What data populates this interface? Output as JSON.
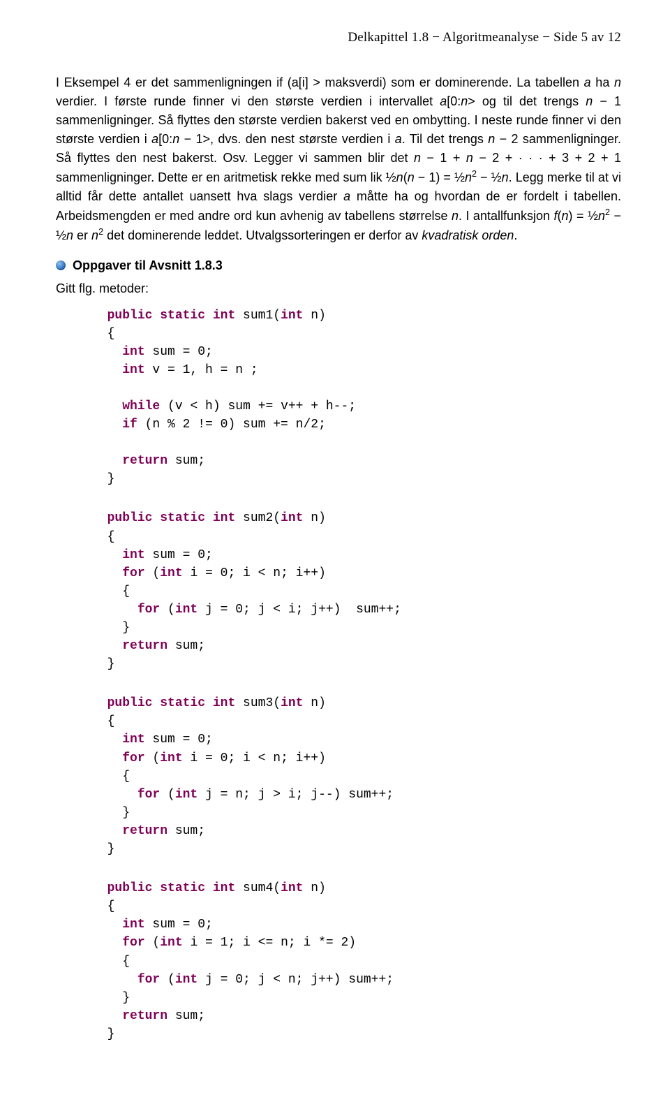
{
  "header": "Delkapittel 1.8 − Algoritmeanalyse − Side 5 av 12",
  "body_html": "I Eksempel 4 er det sammenligningen if (a[i] > maksverdi) som er dominerende. La tabellen <i>a</i> ha <i>n</i> verdier. I første runde finner vi den største verdien i intervallet <i>a</i>[0:<i>n</i>> og til det trengs <i>n</i> − 1 sammenligninger. Så flyttes den største verdien bakerst ved en ombytting. I neste runde finner vi den største verdien i <i>a</i>[0:<i>n</i> − 1>, dvs. den nest største verdien i <i>a</i>. Til det trengs <i>n</i> − 2 sammenligninger. Så flyttes den nest bakerst. Osv. Legger vi sammen blir det <i>n</i> − 1 + <i>n</i> − 2 + · · · + 3 + 2 + 1 sammenligninger. Dette er en aritmetisk rekke med sum lik ½<i>n</i>(<i>n</i> − 1) = ½<i>n</i><sup>2</sup> − ½<i>n</i>. Legg merke til at vi alltid får dette antallet uansett hva slags verdier <i>a</i> måtte ha og hvordan de er fordelt i tabellen. Arbeidsmengden er med andre ord kun avhenig av tabellens størrelse <i>n</i>. I antallfunksjon <i>f</i>(<i>n</i>) = ½<i>n</i><sup>2</sup> − ½<i>n</i> er <i>n</i><sup>2</sup> det dominerende leddet. Utvalgssorteringen er derfor av <i>kvadratisk orden</i>.",
  "section_title": "Oppgaver til Avsnitt 1.8.3",
  "subnote": "Gitt flg. metoder:",
  "code": [
    {
      "name": "sum1",
      "lines": [
        {
          "t": "sig",
          "method": "sum1"
        },
        {
          "t": "raw",
          "s": "  {"
        },
        {
          "t": "decl",
          "s": "    ",
          "rest": " sum = 0;"
        },
        {
          "t": "decl",
          "s": "    ",
          "rest": " v = 1, h = n ;"
        },
        {
          "t": "blank"
        },
        {
          "t": "kwline",
          "s": "    ",
          "kw": "while",
          "rest": " (v < h) sum += v++ + h--;"
        },
        {
          "t": "kwline",
          "s": "    ",
          "kw": "if",
          "rest": " (n % 2 != 0) sum += n/2;"
        },
        {
          "t": "blank"
        },
        {
          "t": "kwline",
          "s": "    ",
          "kw": "return",
          "rest": " sum;"
        },
        {
          "t": "raw",
          "s": "  }"
        }
      ]
    },
    {
      "name": "sum2",
      "lines": [
        {
          "t": "sig",
          "method": "sum2"
        },
        {
          "t": "raw",
          "s": "  {"
        },
        {
          "t": "decl",
          "s": "    ",
          "rest": " sum = 0;"
        },
        {
          "t": "for",
          "s": "    ",
          "rest1": " (",
          "rest2": " i = 0; i < n; i++)"
        },
        {
          "t": "raw",
          "s": "    {"
        },
        {
          "t": "for",
          "s": "      ",
          "rest1": " (",
          "rest2": " j = 0; j < i; j++)  sum++;"
        },
        {
          "t": "raw",
          "s": "    }"
        },
        {
          "t": "kwline",
          "s": "    ",
          "kw": "return",
          "rest": " sum;"
        },
        {
          "t": "raw",
          "s": "  }"
        }
      ]
    },
    {
      "name": "sum3",
      "lines": [
        {
          "t": "sig",
          "method": "sum3"
        },
        {
          "t": "raw",
          "s": "  {"
        },
        {
          "t": "decl",
          "s": "    ",
          "rest": " sum = 0;"
        },
        {
          "t": "for",
          "s": "    ",
          "rest1": " (",
          "rest2": " i = 0; i < n; i++)"
        },
        {
          "t": "raw",
          "s": "    {"
        },
        {
          "t": "for",
          "s": "      ",
          "rest1": " (",
          "rest2": " j = n; j > i; j--) sum++;"
        },
        {
          "t": "raw",
          "s": "    }"
        },
        {
          "t": "kwline",
          "s": "    ",
          "kw": "return",
          "rest": " sum;"
        },
        {
          "t": "raw",
          "s": "  }"
        }
      ]
    },
    {
      "name": "sum4",
      "lines": [
        {
          "t": "sig",
          "method": "sum4"
        },
        {
          "t": "raw",
          "s": "  {"
        },
        {
          "t": "decl",
          "s": "    ",
          "rest": " sum = 0;"
        },
        {
          "t": "for",
          "s": "    ",
          "rest1": " (",
          "rest2": " i = 1; i <= n; i *= 2)"
        },
        {
          "t": "raw",
          "s": "    {"
        },
        {
          "t": "for",
          "s": "      ",
          "rest1": " (",
          "rest2": " j = 0; j < n; j++) sum++;"
        },
        {
          "t": "raw",
          "s": "    }"
        },
        {
          "t": "kwline",
          "s": "    ",
          "kw": "return",
          "rest": " sum;"
        },
        {
          "t": "raw",
          "s": "  }"
        }
      ]
    }
  ]
}
